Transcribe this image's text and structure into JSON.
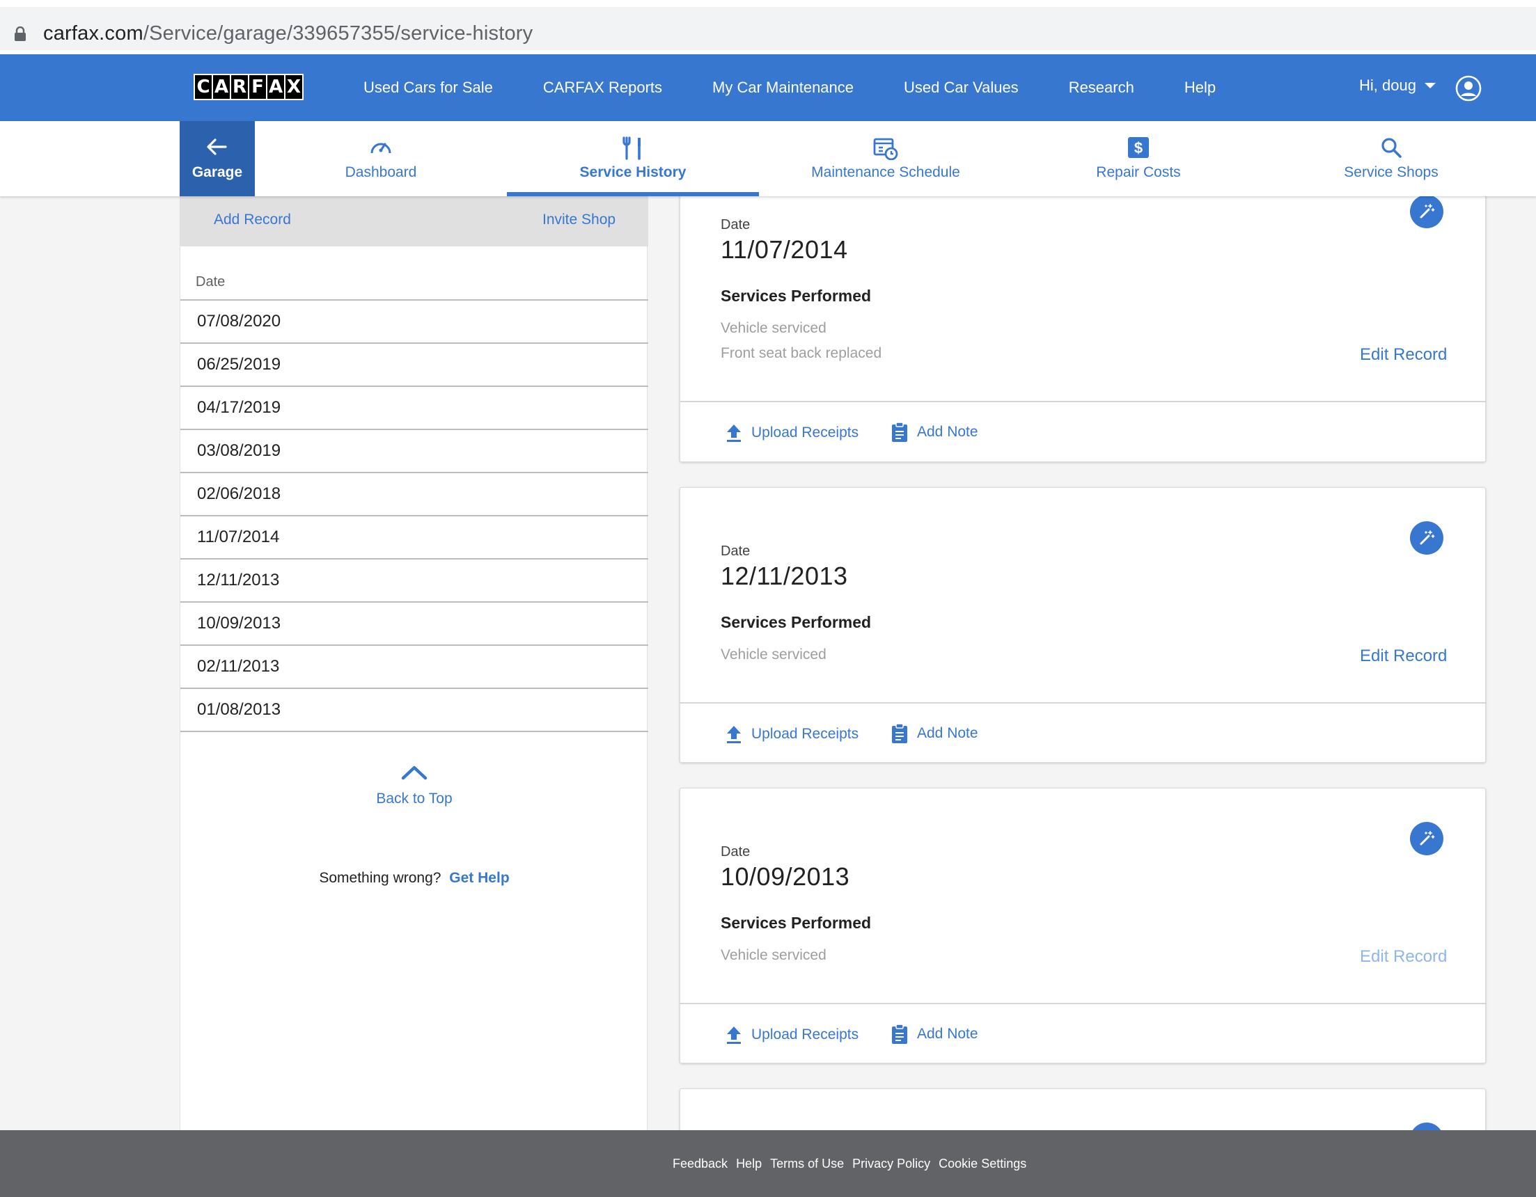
{
  "browser": {
    "url_host": "carfax.com",
    "url_path": "/Service/garage/339657355/service-history"
  },
  "topnav": {
    "logo_letters": [
      "C",
      "A",
      "R",
      "F",
      "A",
      "X"
    ],
    "links": [
      "Used Cars for Sale",
      "CARFAX Reports",
      "My Car Maintenance",
      "Used Car Values",
      "Research",
      "Help"
    ],
    "user_greeting": "Hi, doug"
  },
  "subnav": {
    "garage_label": "Garage",
    "tabs": [
      {
        "label": "Dashboard",
        "icon": "speedometer-icon"
      },
      {
        "label": "Service History",
        "icon": "wrench-screwdriver-icon",
        "active": true
      },
      {
        "label": "Maintenance Schedule",
        "icon": "calendar-clock-icon"
      },
      {
        "label": "Repair Costs",
        "icon": "dollar-icon"
      },
      {
        "label": "Service Shops",
        "icon": "search-icon"
      }
    ]
  },
  "sidebar": {
    "add_record": "Add Record",
    "invite_shop": "Invite Shop",
    "date_header": "Date",
    "dates": [
      "07/08/2020",
      "06/25/2019",
      "04/17/2019",
      "03/08/2019",
      "02/06/2018",
      "11/07/2014",
      "12/11/2013",
      "10/09/2013",
      "02/11/2013",
      "01/08/2013"
    ],
    "back_to_top": "Back to Top",
    "something_wrong": "Something wrong?",
    "get_help": "Get Help"
  },
  "records": [
    {
      "date_label": "Date",
      "date": "11/07/2014",
      "services_title": "Services Performed",
      "services": [
        "Vehicle serviced",
        "Front seat back replaced"
      ],
      "edit": "Edit Record",
      "upload": "Upload Receipts",
      "note": "Add Note"
    },
    {
      "date_label": "Date",
      "date": "12/11/2013",
      "services_title": "Services Performed",
      "services": [
        "Vehicle serviced"
      ],
      "edit": "Edit Record",
      "upload": "Upload Receipts",
      "note": "Add Note"
    },
    {
      "date_label": "Date",
      "date": "10/09/2013",
      "services_title": "Services Performed",
      "services": [
        "Vehicle serviced"
      ],
      "edit": "Edit Record",
      "upload": "Upload Receipts",
      "note": "Add Note"
    }
  ],
  "footer": {
    "links": [
      "Feedback",
      "Help",
      "Terms of Use",
      "Privacy Policy",
      "Cookie Settings"
    ]
  },
  "colors": {
    "brand_blue": "#3777d0",
    "garage_blue": "#2b61ad",
    "footer_gray": "#626366"
  }
}
